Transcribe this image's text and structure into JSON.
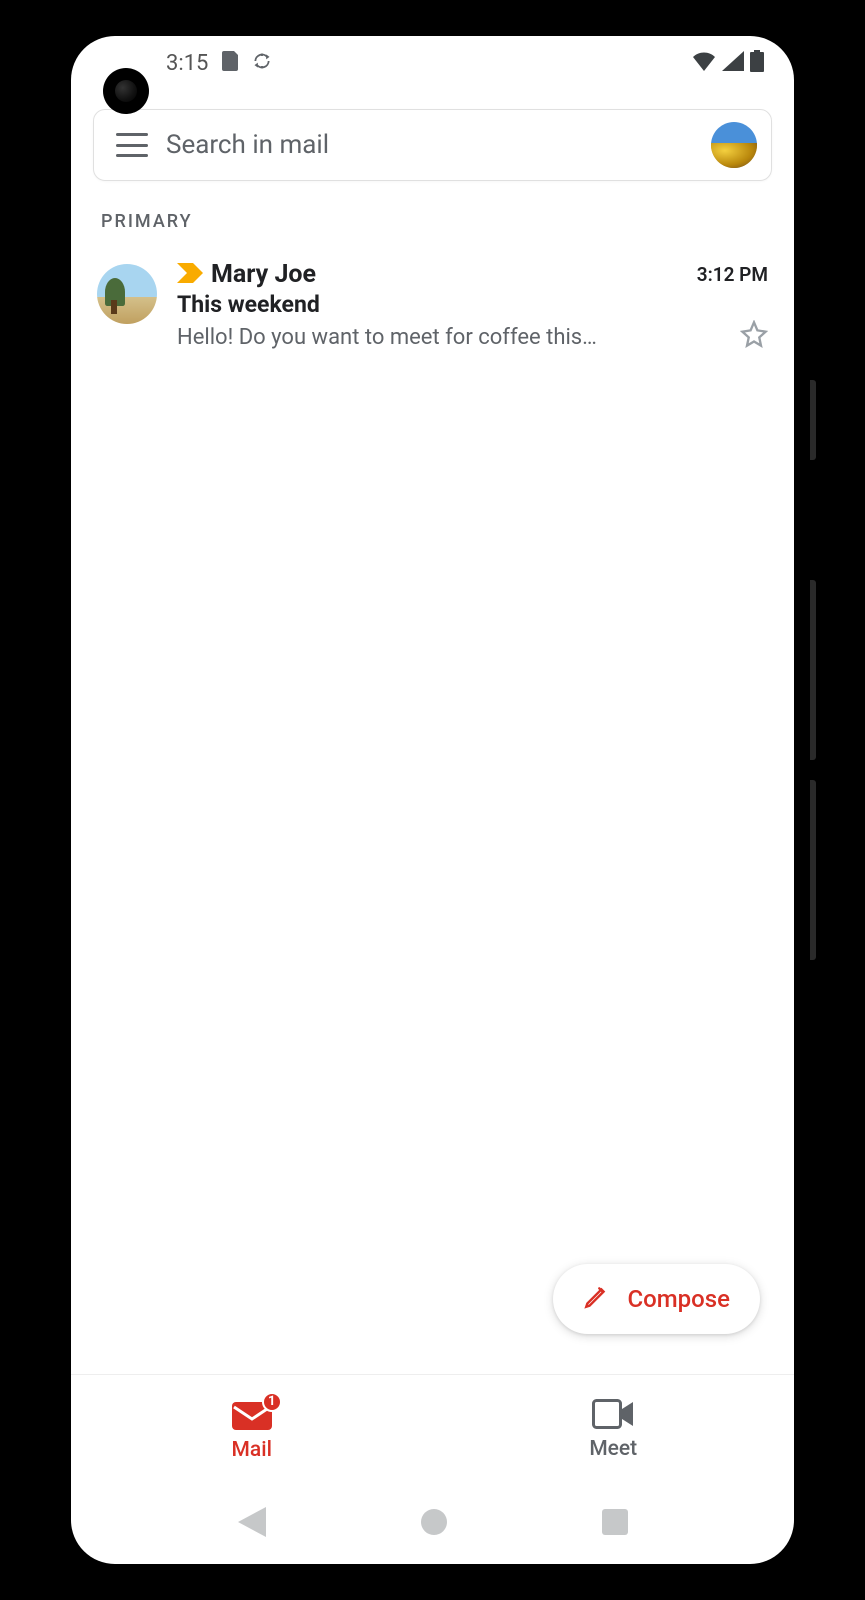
{
  "status": {
    "time": "3:15"
  },
  "search": {
    "placeholder": "Search in mail"
  },
  "section": {
    "title": "PRIMARY"
  },
  "emails": [
    {
      "sender": "Mary Joe",
      "time": "3:12 PM",
      "subject": "This weekend",
      "preview": "Hello! Do you want to meet for coffee this…"
    }
  ],
  "compose": {
    "label": "Compose"
  },
  "nav": {
    "mail": {
      "label": "Mail",
      "badge": "1"
    },
    "meet": {
      "label": "Meet"
    }
  },
  "colors": {
    "accent": "#d93025",
    "text_secondary": "#5f6368",
    "importance": "#f9ab00"
  }
}
